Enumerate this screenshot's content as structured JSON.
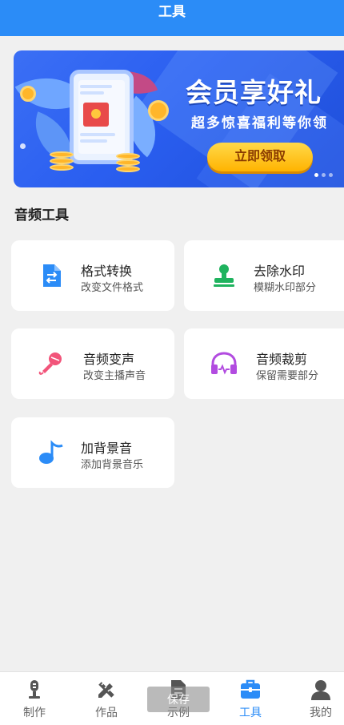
{
  "header": {
    "title": "工具"
  },
  "banner": {
    "title": "会员享好礼",
    "subtitle": "超多惊喜福利等你领",
    "cta": "立即领取",
    "colors": {
      "bg": "#2a5ef0",
      "cta": "#ffc21a"
    }
  },
  "section": {
    "title": "音频工具"
  },
  "tools": [
    {
      "name": "格式转换",
      "desc": "改变文件格式",
      "icon": "file-convert-icon",
      "color": "#2b8cf7"
    },
    {
      "name": "去除水印",
      "desc": "模糊水印部分",
      "icon": "stamp-icon",
      "color": "#1fb35e"
    },
    {
      "name": "音频变声",
      "desc": "改变主播声音",
      "icon": "microphone-icon",
      "color": "#f2547a"
    },
    {
      "name": "音频裁剪",
      "desc": "保留需要部分",
      "icon": "headphones-icon",
      "color": "#b24be0"
    },
    {
      "name": "加背景音",
      "desc": "添加背景音乐",
      "icon": "music-note-icon",
      "color": "#2b8cf7"
    }
  ],
  "tabbar": {
    "items": [
      {
        "label": "制作",
        "icon": "microphone-stand-icon"
      },
      {
        "label": "作品",
        "icon": "pencil-ruler-icon"
      },
      {
        "label": "示例",
        "icon": "document-icon"
      },
      {
        "label": "工具",
        "icon": "toolbox-icon",
        "active": true
      },
      {
        "label": "我的",
        "icon": "user-icon"
      }
    ],
    "active_color": "#2b8cf7"
  },
  "toast": {
    "text": "保存"
  }
}
